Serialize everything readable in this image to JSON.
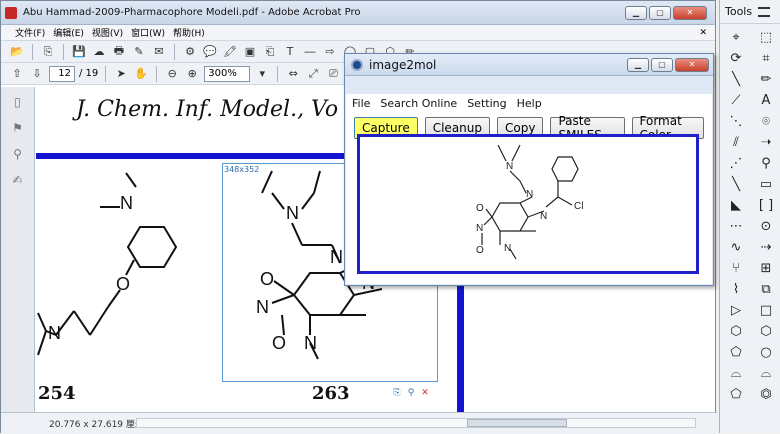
{
  "acrobat": {
    "title": "Abu Hammad-2009-Pharmacophore Modeli.pdf - Adobe Acrobat Pro",
    "menu": [
      "文件(F)",
      "编辑(E)",
      "视图(V)",
      "窗口(W)",
      "帮助(H)"
    ],
    "page_current": "12",
    "page_total": "/ 19",
    "zoom": "300%",
    "status_dims": "20.776 x 27.619 厘米"
  },
  "document": {
    "journal_header": "J. Chem. Inf. Model., Vo",
    "compound_left": "254",
    "compound_right": "263",
    "selection_size": "348x352"
  },
  "tools_pane": {
    "title": "Tools"
  },
  "image2mol": {
    "title": "image2mol",
    "menu": [
      "File",
      "Search Online",
      "Setting",
      "Help"
    ],
    "buttons": {
      "capture": "Capture",
      "cleanup": "Cleanup",
      "copy": "Copy",
      "paste": "Paste SMILES",
      "format": "Format Color"
    },
    "molecule_label": "Cl"
  }
}
